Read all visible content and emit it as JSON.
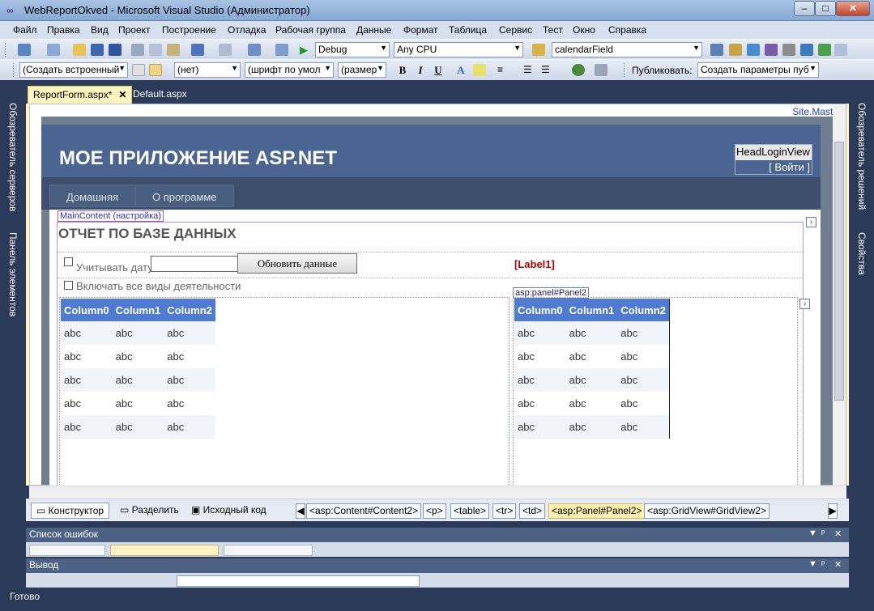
{
  "window": {
    "title": "WebReportOkved - Microsoft Visual Studio (Администратор)"
  },
  "menu": [
    "Файл",
    "Правка",
    "Вид",
    "Проект",
    "Построение",
    "Отладка",
    "Рабочая группа",
    "Данные",
    "Формат",
    "Таблица",
    "Сервис",
    "Тест",
    "Окно",
    "Справка"
  ],
  "toolbar1": {
    "config": "Debug",
    "platform": "Any CPU",
    "find": "calendarField"
  },
  "toolbar2": {
    "style": "(Создать встроенный",
    "block": "(нет)",
    "font": "(шрифт по умол",
    "size": "(размер",
    "bold": "B",
    "italic": "I",
    "underline": "U",
    "publish_label": "Публиковать:",
    "publish_value": "Создать параметры пуб"
  },
  "side": {
    "left_tab1": "Обозреватель серверов",
    "left_tab2": "Панель элементов",
    "right_tab1": "Обозреватель решений",
    "right_tab2": "Свойства"
  },
  "doc_tabs": [
    "ReportForm.aspx*",
    "Default.aspx"
  ],
  "designer": {
    "site_master": "Site.Master",
    "app_heading": "МОЕ ПРИЛОЖЕНИЕ ASP.NET",
    "login_view": "HeadLoginView",
    "login_link": "[ Войти ]",
    "nav": [
      "Домашняя",
      "О программе"
    ],
    "main_content_tag": "MainContent (настройка)",
    "report_title": "ОТЧЕТ ПО БАЗЕ ДАННЫХ",
    "checkbox_date": "Учитывать дату",
    "refresh_button": "Обновить данные",
    "label1": "[Label1]",
    "checkbox_all": "Включать все виды деятельности",
    "panel_tag": "asp:panel#Panel2",
    "grid_headers": [
      "Column0",
      "Column1",
      "Column2"
    ],
    "grid_rows": [
      [
        "abc",
        "abc",
        "abc"
      ],
      [
        "abc",
        "abc",
        "abc"
      ],
      [
        "abc",
        "abc",
        "abc"
      ],
      [
        "abc",
        "abc",
        "abc"
      ],
      [
        "abc",
        "abc",
        "abc"
      ]
    ]
  },
  "viewbar": {
    "views": [
      "Конструктор",
      "Разделить",
      "Исходный код"
    ],
    "breadcrumbs": [
      "<asp:Content#Content2>",
      "<p>",
      "<table>",
      "<tr>",
      "<td>",
      "<asp:Panel#Panel2>",
      "<asp:GridView#GridView2>"
    ]
  },
  "panels": {
    "errors": "Список ошибок",
    "output": "Вывод"
  },
  "status": "Готово"
}
